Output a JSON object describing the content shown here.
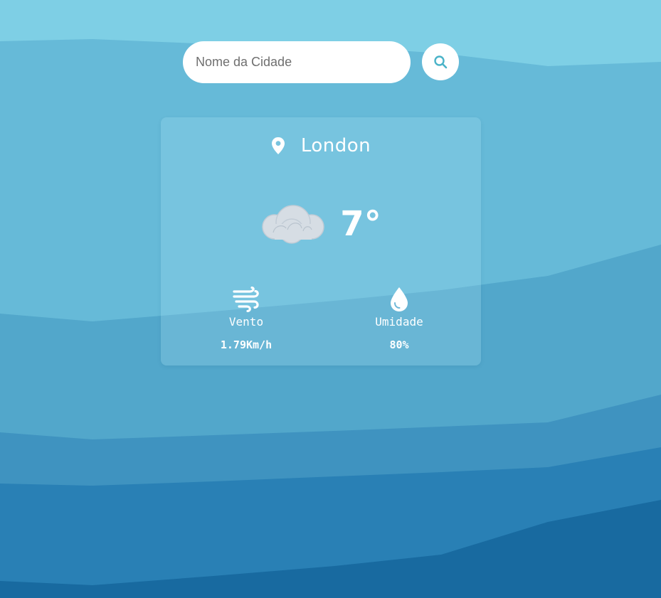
{
  "search": {
    "placeholder": "Nome da Cidade",
    "button_icon": "search-icon"
  },
  "weather": {
    "city": "London",
    "location_icon": "map-pin-icon",
    "condition_icon": "cloud-icon",
    "temperature": "7°",
    "wind": {
      "icon": "wind-icon",
      "label": "Vento",
      "value": "1.79Km/h"
    },
    "humidity": {
      "icon": "water-drop-icon",
      "label": "Umidade",
      "value": "80%"
    }
  },
  "colors": {
    "sky_top": "#7ecfe5",
    "wave_1": "#66bad8",
    "wave_2": "#52a7cb",
    "wave_3": "#3f93c0",
    "wave_4": "#2980b5",
    "wave_5": "#186aa0",
    "accent": "#4ab3c8",
    "text": "#ffffff"
  }
}
